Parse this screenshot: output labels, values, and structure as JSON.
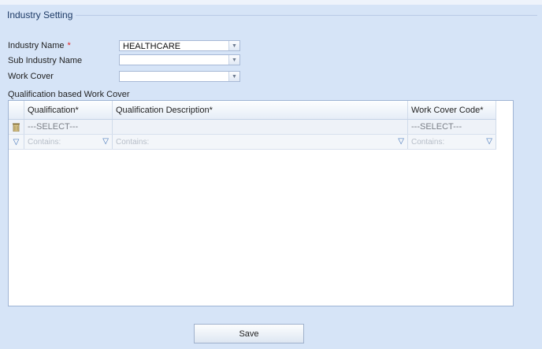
{
  "fieldset": {
    "legend": "Industry Setting"
  },
  "form": {
    "industry_name": {
      "label": "Industry Name",
      "required_mark": "*",
      "value": "HEALTHCARE"
    },
    "sub_industry_name": {
      "label": "Sub Industry Name",
      "value": ""
    },
    "work_cover": {
      "label": "Work Cover",
      "value": ""
    }
  },
  "grid": {
    "title": "Qualification based Work Cover",
    "columns": [
      "Qualification*",
      "Qualification Description*",
      "Work Cover Code*"
    ],
    "new_row": {
      "qualification": "---SELECT---",
      "description": "",
      "work_cover_code": "---SELECT---"
    },
    "filter_placeholder": "Contains:"
  },
  "actions": {
    "save_label": "Save"
  },
  "icons": {
    "dropdown": "chevron-down-icon",
    "delete": "trash-icon",
    "filter": "filter-icon"
  },
  "colors": {
    "background": "#d6e4f7",
    "accent": "#3d6fb5",
    "required": "#dd2222"
  }
}
